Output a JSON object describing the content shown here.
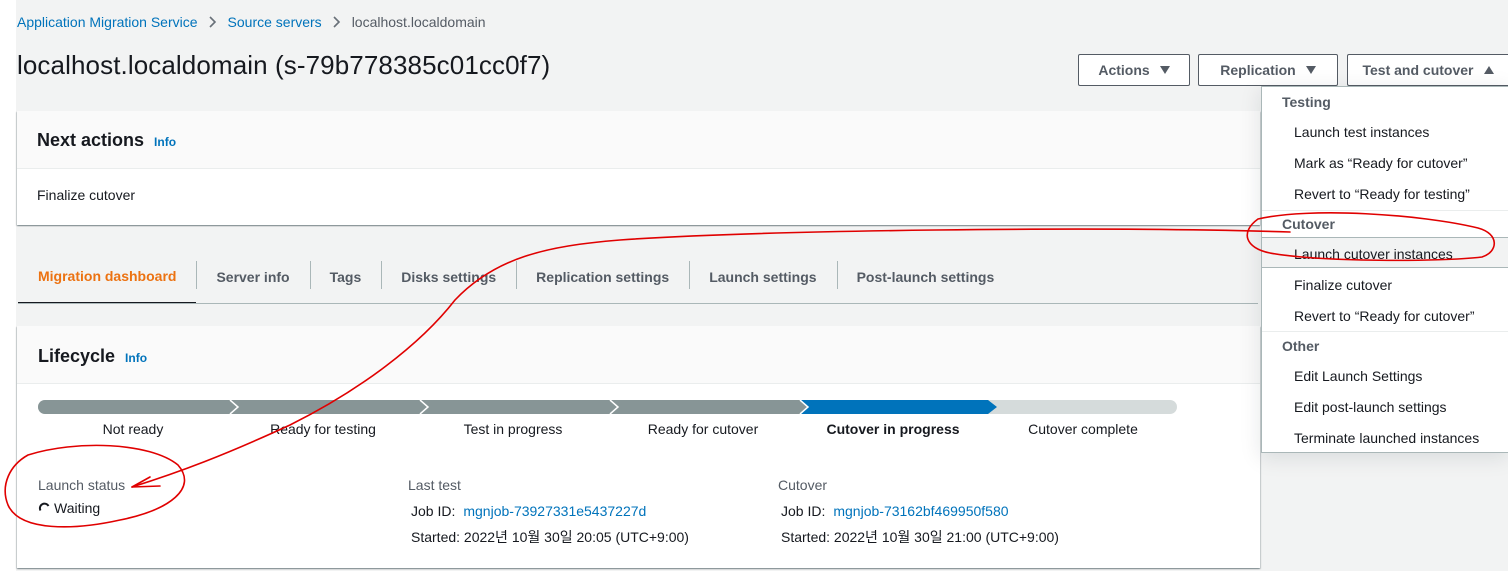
{
  "breadcrumb": {
    "items": [
      "Application Migration Service",
      "Source servers",
      "localhost.localdomain"
    ]
  },
  "page": {
    "title": "localhost.localdomain (s-79b778385c01cc0f7)"
  },
  "header_buttons": {
    "actions": "Actions",
    "replication": "Replication",
    "test_cutover": "Test and cutover"
  },
  "next_actions": {
    "title": "Next actions",
    "info": "Info",
    "text": "Finalize cutover"
  },
  "tabs": [
    "Migration dashboard",
    "Server info",
    "Tags",
    "Disks settings",
    "Replication settings",
    "Launch settings",
    "Post-launch settings"
  ],
  "lifecycle": {
    "title": "Lifecycle",
    "info": "Info",
    "steps": [
      "Not ready",
      "Ready for testing",
      "Test in progress",
      "Ready for cutover",
      "Cutover in progress",
      "Cutover complete"
    ],
    "current_step": "Cutover in progress",
    "colors": {
      "done": "#879596",
      "current": "#0073bb",
      "pending": "#d5dbdb"
    },
    "launch_status": {
      "label": "Launch status",
      "value": "Waiting"
    },
    "last_test": {
      "label": "Last test",
      "job_label": "Job ID:",
      "job_id": "mgnjob-73927331e5437227d",
      "started": "Started: 2022년 10월 30일 20:05 (UTC+9:00)"
    },
    "cutover": {
      "label": "Cutover",
      "job_label": "Job ID:",
      "job_id": "mgnjob-73162bf469950f580",
      "started": "Started: 2022년 10월 30일 21:00 (UTC+9:00)"
    }
  },
  "dropdown": {
    "groups": [
      {
        "label": "Testing",
        "items": [
          "Launch test instances",
          "Mark as “Ready for cutover”",
          "Revert to “Ready for testing”"
        ]
      },
      {
        "label": "Cutover",
        "items": [
          "Launch cutover instances",
          "Finalize cutover",
          "Revert to “Ready for cutover”"
        ]
      },
      {
        "label": "Other",
        "items": [
          "Edit Launch Settings",
          "Edit post-launch settings",
          "Terminate launched instances"
        ]
      }
    ],
    "highlighted": "Launch cutover instances"
  },
  "colors": {
    "link": "#0073bb",
    "active_tab": "#ec7211",
    "annotation": "#e00000"
  }
}
